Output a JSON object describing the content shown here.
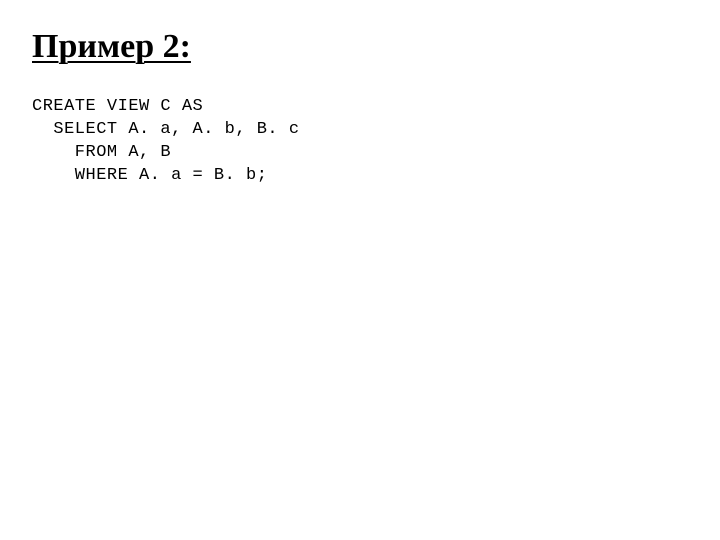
{
  "heading": "Пример 2:",
  "code": {
    "line1": "CREATE VIEW C AS",
    "line2": "  SELECT A. a, A. b, B. c",
    "line3": "    FROM A, B",
    "line4": "    WHERE A. a = B. b;"
  }
}
